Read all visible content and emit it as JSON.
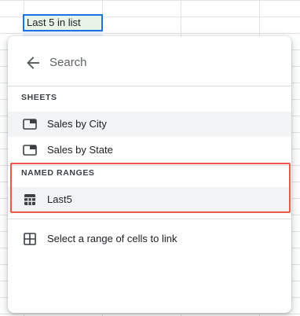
{
  "cell": {
    "text": "Last 5 in list"
  },
  "popup": {
    "search_placeholder": "Search",
    "sections": [
      {
        "title": "SHEETS",
        "items": [
          {
            "label": "Sales by City",
            "icon": "sheet-tab-icon",
            "highlighted": true
          },
          {
            "label": "Sales by State",
            "icon": "sheet-tab-icon",
            "highlighted": false
          }
        ]
      },
      {
        "title": "NAMED RANGES",
        "items": [
          {
            "label": "Last5",
            "icon": "named-range-icon",
            "highlighted": true
          }
        ]
      }
    ],
    "footer_item": {
      "label": "Select a range of cells to link",
      "icon": "grid-icon"
    }
  },
  "colors": {
    "highlight_border": "#e8584b",
    "cell_border": "#1a73e8",
    "cell_fill": "#e8f4e8"
  }
}
